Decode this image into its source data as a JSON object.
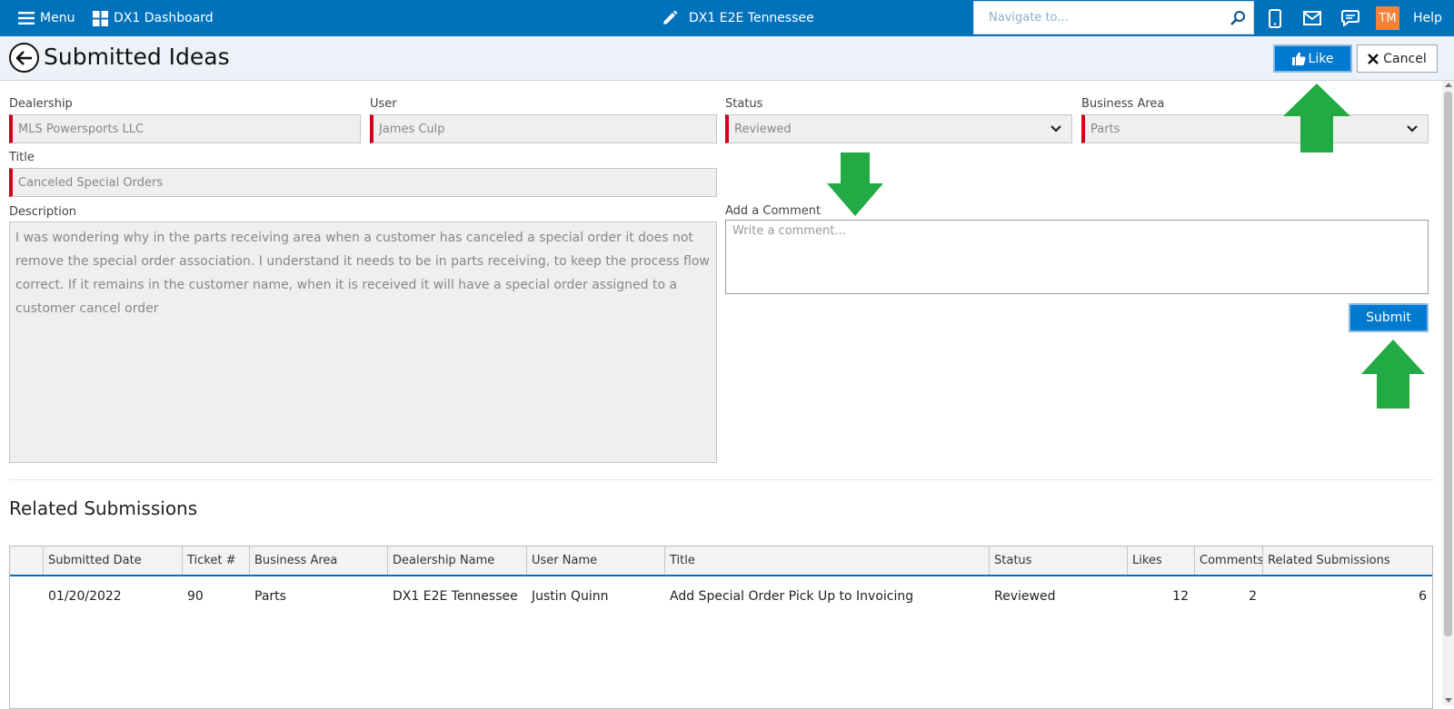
{
  "topbar": {
    "menu_label": "Menu",
    "dashboard_label": "DX1 Dashboard",
    "location_label": "DX1 E2E Tennessee",
    "search_placeholder": "Navigate to...",
    "avatar_initials": "TM",
    "help_label": "Help",
    "bg_color": "#0072bc",
    "avatar_color": "#f4813c"
  },
  "header": {
    "title": "Submitted Ideas",
    "like_label": "Like",
    "cancel_label": "Cancel"
  },
  "form": {
    "dealership_label": "Dealership",
    "dealership_value": "MLS Powersports LLC",
    "user_label": "User",
    "user_value": "James Culp",
    "status_label": "Status",
    "status_value": "Reviewed",
    "business_area_label": "Business Area",
    "business_area_value": "Parts",
    "title_label": "Title",
    "title_value": "Canceled Special Orders",
    "description_label": "Description",
    "description_value": "I was wondering why in the parts receiving area when a customer has canceled a special order it does not remove the special order association. I understand it needs to be in parts receiving, to keep the process flow correct. If it remains in the customer name, when it is received it will have a special order assigned to a customer cancel order",
    "comment_label": "Add a Comment",
    "comment_placeholder": "Write a comment...",
    "submit_label": "Submit",
    "required_color": "#d0021b"
  },
  "related": {
    "title": "Related Submissions",
    "columns": [
      "",
      "Submitted Date",
      "Ticket #",
      "Business Area",
      "Dealership Name",
      "User Name",
      "Title",
      "Status",
      "Likes",
      "Comments",
      "Related Submissions"
    ],
    "rows": [
      {
        "submitted_date": "01/20/2022",
        "ticket": "90",
        "business_area": "Parts",
        "dealership_name": "DX1 E2E Tennessee",
        "user_name": "Justin Quinn",
        "title": "Add Special Order Pick Up to Invoicing",
        "status": "Reviewed",
        "likes": "12",
        "comments": "2",
        "related_submissions": "6"
      }
    ]
  },
  "annotations": {
    "arrow_color": "#22aa44"
  }
}
